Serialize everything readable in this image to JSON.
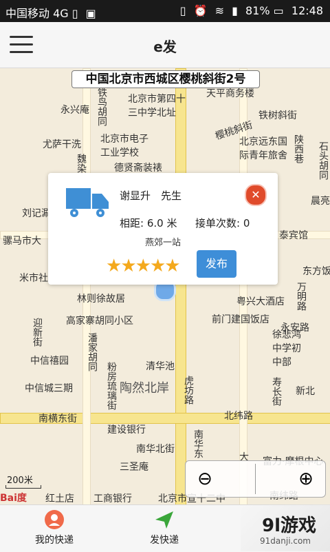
{
  "status_bar": {
    "carrier": "中国移动 4G",
    "battery": "81%",
    "time": "12:48"
  },
  "app_bar": {
    "title": "e发"
  },
  "map": {
    "address": "中国北京市西城区樱桃斜街2号",
    "pois": [
      "铁鸟胡同",
      "北京市第四十三中学北址",
      "天平商务楼",
      "永兴庵",
      "樱桃斜街",
      "铁树斜街",
      "尤萨干洗",
      "北京市电子工业学校",
      "北京远东国际青年旅舍",
      "陕西巷",
      "石头胡同",
      "德贤斋装裱",
      "魏染胡同",
      "刘记涮羊",
      "骡马市大",
      "晨亮",
      "泰宾馆",
      "东方饭",
      "米市社",
      "林则徐故居",
      "粤兴大酒店",
      "万明路",
      "高家寨胡同小区",
      "前门建国饭店",
      "永安路",
      "迎新街",
      "中信禧园",
      "潘家胡同",
      "徐悲鸿中学初中部",
      "清华池",
      "粉房琉璃街",
      "中信城三期",
      "陶然北岸",
      "虎坊路",
      "寿长街",
      "新北",
      "南横东街",
      "北纬路",
      "建设银行",
      "南华北街",
      "三圣庵",
      "南华东",
      "大",
      "富力·摩根中心",
      "红土店",
      "工商银行",
      "北京市宣十二中",
      "南纬路"
    ],
    "scale": "200米",
    "baidu_logo": "Bai度"
  },
  "card": {
    "name": "谢显升　先生",
    "distance": "相距: 6.0 米",
    "order_count": "接单次数: 0",
    "station": "燕郊一站",
    "rating": 5,
    "publish_label": "发布"
  },
  "bottom_nav": {
    "items": [
      {
        "label": "我的快递"
      },
      {
        "label": "发快递"
      }
    ]
  },
  "watermark": {
    "brand": "9l游戏",
    "url": "91danji.com"
  }
}
